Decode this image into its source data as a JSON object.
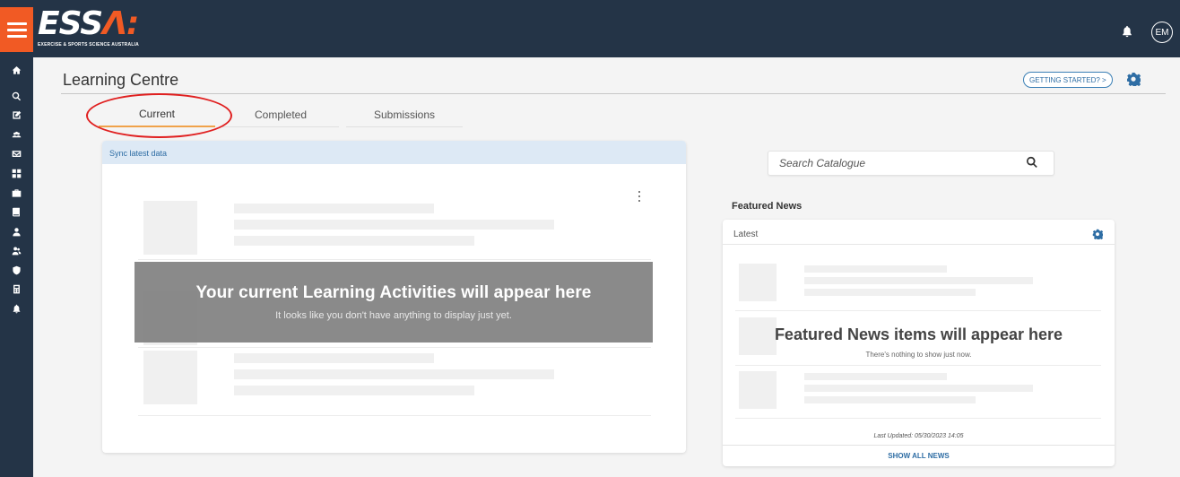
{
  "header": {
    "logo_text_main": "ESS",
    "logo_text_accent": "Λ:",
    "logo_tagline": "EXERCISE & SPORTS SCIENCE AUSTRALIA",
    "avatar_initials": "EM",
    "bell_icon": "bell-icon",
    "menu_icon": "hamburger-icon"
  },
  "sidebar": {
    "icons": [
      "home-icon",
      "search-icon",
      "edit-icon",
      "users-icon",
      "mail-icon",
      "grid-icon",
      "briefcase-icon",
      "book-icon",
      "user-icon",
      "user-group-icon",
      "shield-icon",
      "calculator-icon",
      "bell-icon"
    ]
  },
  "page": {
    "title": "Learning Centre",
    "getting_started": "GETTING STARTED? >"
  },
  "tabs": [
    {
      "label": "Current",
      "active": true
    },
    {
      "label": "Completed",
      "active": false
    },
    {
      "label": "Submissions",
      "active": false
    }
  ],
  "activities": {
    "sync_label": "Sync latest data",
    "empty_title": "Your current Learning Activities will appear here",
    "empty_subtitle": "It looks like you don't have anything to display just yet."
  },
  "catalogue": {
    "search_placeholder": "Search Catalogue"
  },
  "news": {
    "section_label": "Featured News",
    "filter_label": "Latest",
    "empty_title": "Featured News items will appear here",
    "empty_subtitle": "There's nothing to show just now.",
    "last_updated": "Last Updated: 05/30/2023 14:05",
    "show_all": "SHOW ALL NEWS"
  },
  "colors": {
    "navy": "#243447",
    "brand_orange": "#f15a24",
    "link_blue": "#2e6da4",
    "tab_underline": "#f0a24a",
    "annotation_red": "#e02020"
  }
}
